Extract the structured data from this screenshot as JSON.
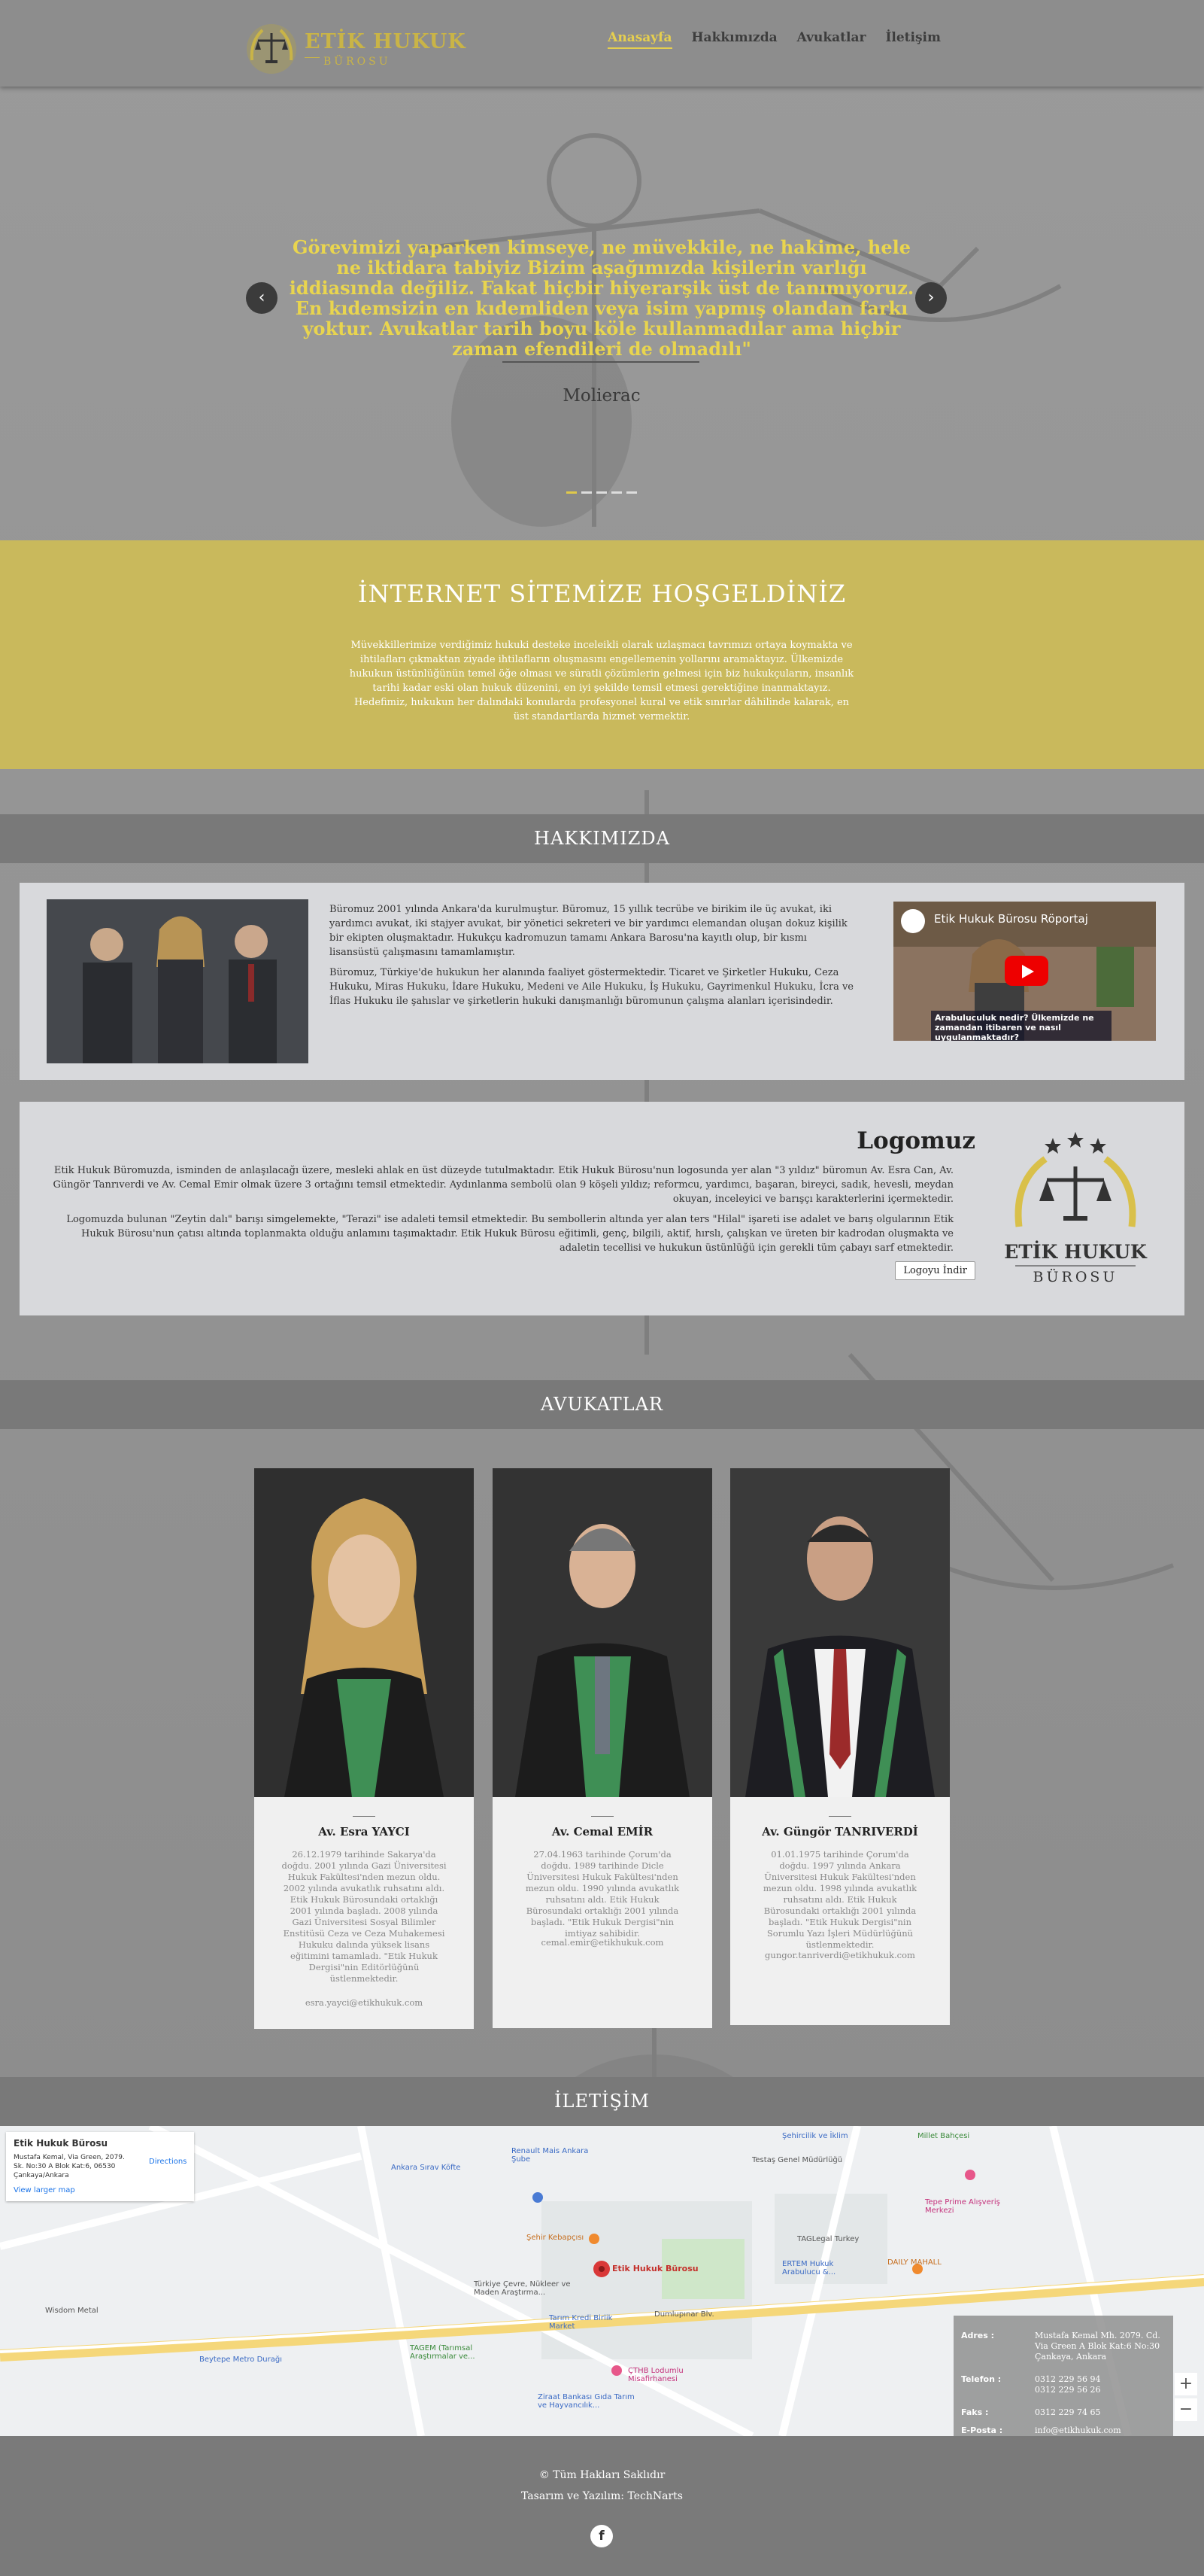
{
  "colors": {
    "gold": "#e6cf4e",
    "welcome_bg": "#c9b95c",
    "section_bar": "#797979"
  },
  "brand": {
    "title": "ETİK HUKUK",
    "subtitle": "BÜROSU"
  },
  "nav": [
    {
      "label": "Anasayfa",
      "active": true
    },
    {
      "label": "Hakkımızda"
    },
    {
      "label": "Avukatlar"
    },
    {
      "label": "İletişim"
    }
  ],
  "hero": {
    "quote": "Görevimizi yaparken kimseye, ne müvekkile, ne hakime, hele ne iktidara tabiyiz Bizim aşağımızda kişilerin varlığı iddiasında değiliz. Fakat hiçbir hiyerarşik üst de tanımıyoruz. En kıdemsizin en kıdemliden veya isim yapmış olandan farkı yoktur. Avukatlar tarih boyu köle kullanmadılar ama hiçbir zaman efendileri de olmadılı\"",
    "author": "Molierac",
    "prev_icon": "‹",
    "next_icon": "›"
  },
  "welcome": {
    "title": "İNTERNET SİTEMİZE HOŞGELDİNİZ",
    "text1": "Müvekkillerimize verdiğimiz hukuki desteke inceleikli olarak uzlaşmacı tavrımızı ortaya koymakta ve ihtilafları çıkmaktan ziyade ihtilafların oluşmasını engellemenin yollarını aramaktayız. Ülkemizde hukukun üstünlüğünün temel öğe olması ve süratli çözümlerin gelmesi için biz hukukçuların, insanlık tarihi kadar eski olan hukuk düzenini, en iyi şekilde temsil etmesi gerektiğine inanmaktayız.",
    "text2": "Hedefimiz, hukukun her dalındaki konularda profesyonel kural ve etik sınırlar dâhilinde kalarak, en üst standartlarda hizmet vermektir."
  },
  "about": {
    "heading": "HAKKIMIZDA",
    "p1": "Büromuz 2001 yılında Ankara'da kurulmuştur. Büromuz, 15 yıllık tecrübe ve birikim ile üç avukat, iki yardımcı avukat, iki stajyer avukat, bir yönetici sekreteri ve bir yardımcı elemandan oluşan dokuz kişilik bir ekipten oluşmaktadır. Hukukçu kadromuzun tamamı Ankara Barosu'na kayıtlı olup, bir kısmı lisansüstü çalışmasını tamamlamıştır.",
    "p2": "Büromuz, Türkiye'de hukukun her alanında faaliyet göstermektedir. Ticaret ve Şirketler Hukuku, Ceza Hukuku, Miras Hukuku, İdare Hukuku, Medeni ve Aile Hukuku, İş Hukuku, Gayrimenkul Hukuku, İcra ve İflas Hukuku ile şahıslar ve şirketlerin hukuki danışmanlığı büromunun çalışma alanları içerisindedir.",
    "video_title": "Etik Hukuk Bürosu Röportaj",
    "video_caption": "Arabuluculuk nedir? Ülkemizde ne zamandan itibaren ve nasıl uygulanmaktadır?"
  },
  "logo_section": {
    "heading": "Logomuz",
    "p1": "Etik Hukuk Büromuzda, isminden de anlaşılacağı üzere, mesleki ahlak en üst düzeyde tutulmaktadır. Etik Hukuk Bürosu'nun logosunda yer alan \"3 yıldız\" büromun Av. Esra Can, Av. Güngör Tanrıverdi ve Av. Cemal Emir olmak üzere 3 ortağını temsil etmektedir. Aydınlanma sembolü olan 9 köşeli yıldız; reformcu, yardımcı, başaran, bireyci, sadık, hevesli, meydan okuyan, inceleyici ve barışçı karakterlerini içermektedir.",
    "p2": "Logomuzda bulunan \"Zeytin dalı\" barışı simgelemekte, \"Terazi\" ise adaleti temsil etmektedir. Bu sembollerin altında yer alan ters \"Hilal\" işareti ise adalet ve barış olgularının Etik Hukuk Bürosu'nun çatısı altında toplanmakta olduğu anlamını taşımaktadır. Etik Hukuk Bürosu eğitimli, genç, bilgili, aktif, hırslı, çalışkan ve üreten bir kadrodan oluşmakta ve adaletin tecellisi ve hukukun üstünlüğü için gerekli tüm çabayı sarf etmektedir.",
    "button": "Logoyu İndir"
  },
  "lawyers_heading": "AVUKATLAR",
  "lawyers": [
    {
      "name": "Av. Esra YAYCI",
      "bio": "26.12.1979 tarihinde Sakarya'da doğdu. 2001 yılında Gazi Üniversitesi Hukuk Fakültesi'nden mezun oldu. 2002 yılında avukatlık ruhsatını aldı. Etik Hukuk Bürosundaki ortaklığı 2001 yılında başladı. 2008 yılında Gazi Üniversitesi Sosyal Bilimler Enstitüsü Ceza ve Ceza Muhakemesi Hukuku dalında yüksek lisans eğitimini tamamladı. \"Etik Hukuk Dergisi\"nin Editörlüğünü üstlenmektedir.",
      "email": "esra.yayci@etikhukuk.com"
    },
    {
      "name": "Av. Cemal EMİR",
      "bio": "27.04.1963 tarihinde Çorum'da doğdu. 1989 tarihinde Dicle Üniversitesi Hukuk Fakültesi'nden mezun oldu. 1990 yılında avukatlık ruhsatını aldı. Etik Hukuk Bürosundaki ortaklığı 2001 yılında başladı. \"Etik Hukuk Dergisi\"nin imtiyaz sahibidir.",
      "email": "cemal.emir@etikhukuk.com"
    },
    {
      "name": "Av. Güngör TANRIVERDİ",
      "bio": "01.01.1975 tarihinde Çorum'da doğdu. 1997 yılında Ankara Üniversitesi Hukuk Fakültesi'nden mezun oldu. 1998 yılında avukatlık ruhsatını aldı. Etik Hukuk Bürosundaki ortaklığı 2001 yılında başladı. \"Etik Hukuk Dergisi\"nin Sorumlu Yazı İşleri Müdürlüğünü üstlenmektedir.",
      "email": "gungor.tanriverdi@etikhukuk.com"
    }
  ],
  "contact": {
    "heading": "İLETİŞİM",
    "map_place": "Etik Hukuk Bürosu",
    "map_address": "Mustafa Kemal, Via Green, 2079. Sk. No:30 A Blok Kat:6, 06530 Çankaya/Ankara",
    "directions": "Directions",
    "larger_map": "View larger map",
    "pin_label": "Etik Hukuk Bürosu",
    "map_labels": [
      "Şehir Kebapçısı",
      "Renault Mais Ankara Şube",
      "Tarım Kredi Birlik Market",
      "Dumlupınar Blv.",
      "Türkiye Çevre, Nükleer ve Maden Araştırma...",
      "Beytepe Metro Durağı",
      "Wisdom Metal",
      "TAGLegal Turkey",
      "DAILY MAHALL",
      "ERTEM Hukuk Arabulucu &...",
      "Tepe Prime Alışveriş Merkezi",
      "Millet Bahçesi",
      "Şehircilik ve İklim",
      "Testaş Genel Müdürlüğü",
      "Ankara Sırav Köfte",
      "ÇTHB Lodumlu Misafirhanesi",
      "TAGEM (Tarımsal Araştırmalar ve...",
      "Ziraat Bankası Gıda Tarım ve Hayvancılık..."
    ],
    "address_label": "Adres :",
    "address_value": "Mustafa Kemal Mh. 2079. Cd. Via Green A Blok Kat:6 No:30 Çankaya, Ankara",
    "phone_label": "Telefon :",
    "phone_value": "0312 229 56 94\n0312 229 56 26",
    "fax_label": "Faks :",
    "fax_value": "0312 229 74 65",
    "email_label": "E-Posta :",
    "email_value": "info@etikhukuk.com"
  },
  "footer": {
    "copyright": "© Tüm Hakları Saklıdır",
    "design": "Tasarım ve Yazılım: TechNarts",
    "facebook": "f"
  }
}
